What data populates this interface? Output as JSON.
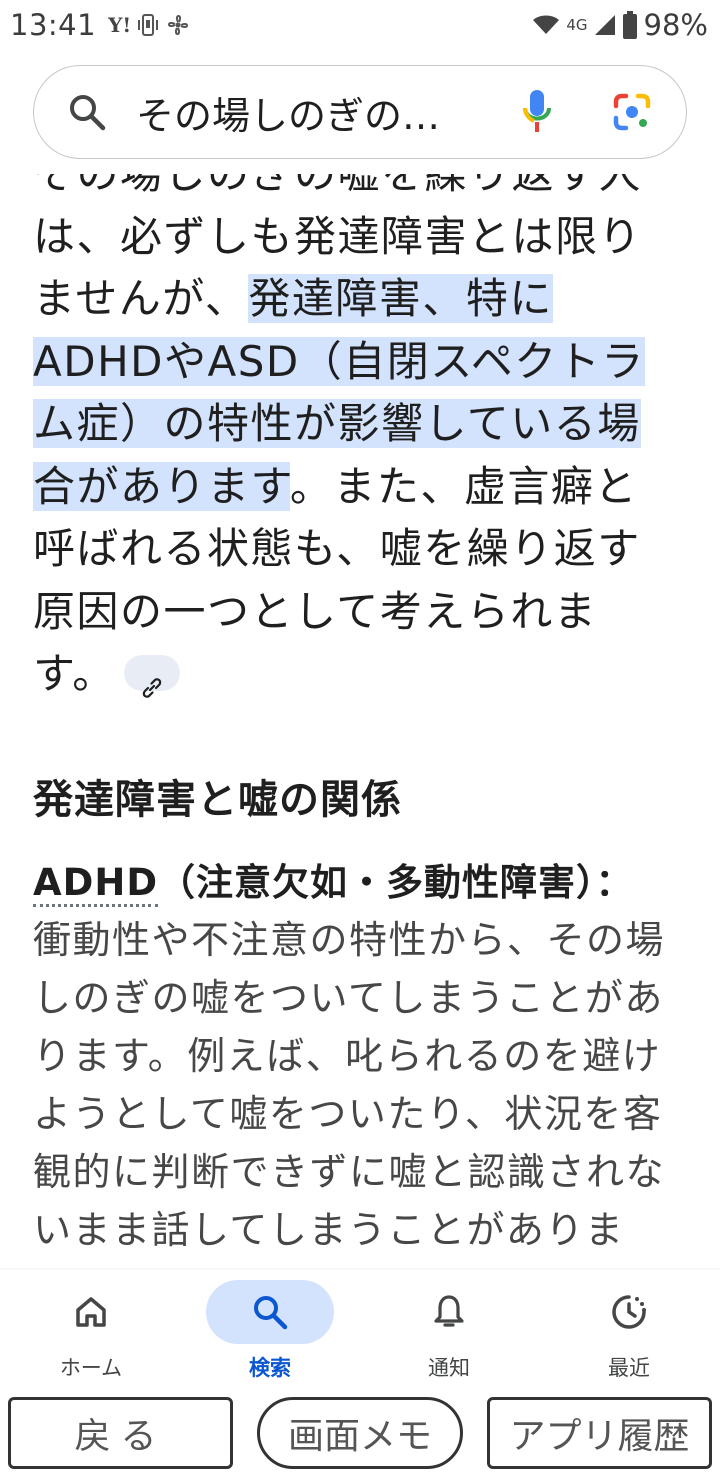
{
  "status_bar": {
    "time": "13:41",
    "yahoo": "Y!",
    "network": "4G",
    "battery": "98%"
  },
  "search": {
    "query": "その場しのぎの…"
  },
  "article": {
    "paragraph_plain_1": "その場しのぎの嘘を繰り返す人は、必ずしも発達障害とは限りませんが、",
    "paragraph_highlight": "発達障害、特にADHDやASD（自閉スペクトラム症）の特性が影響している場合があります",
    "paragraph_plain_2": "。また、虚言癖と呼ばれる状態も、嘘を繰り返す原因の一つとして考えられます。",
    "section_heading": "発達障害と嘘の関係",
    "term_abbr": "ADHD",
    "term_rest": "（注意欠如・多動性障害）：",
    "description": "衝動性や不注意の特性から、その場しのぎの嘘をついてしまうことがあります。例えば、叱られるのを避けようとして嘘をついたり、状況を客観的に判断できずに嘘と認識されないまま話してしまうことがあります。"
  },
  "bottom_nav": {
    "items": [
      {
        "label": "ホーム",
        "icon": "home-icon"
      },
      {
        "label": "検索",
        "icon": "search-icon",
        "active": true
      },
      {
        "label": "通知",
        "icon": "bell-icon"
      },
      {
        "label": "最近",
        "icon": "recent-icon"
      }
    ]
  },
  "system_nav": {
    "back": "戻る",
    "memo": "画面メモ",
    "history": "アプリ履歴"
  },
  "colors": {
    "highlight": "#d3e3fd",
    "accent": "#0b57d0"
  }
}
